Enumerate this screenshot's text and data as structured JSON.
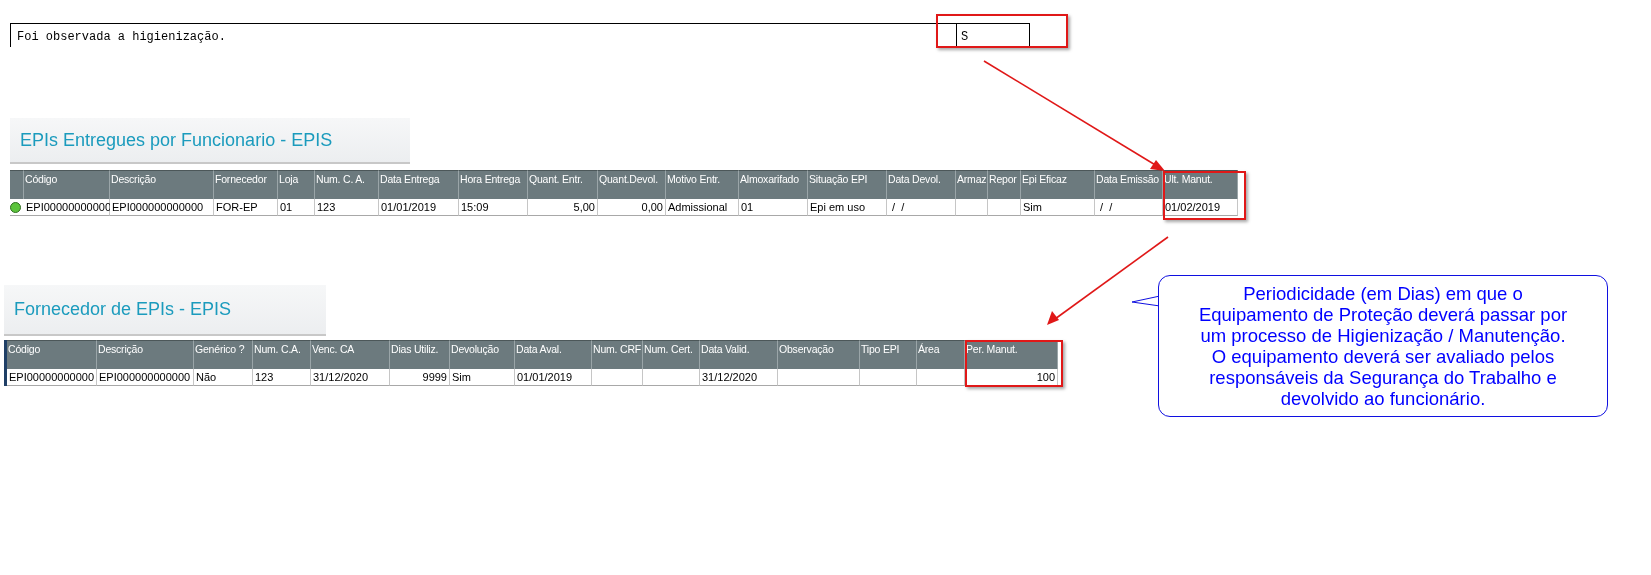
{
  "note_row": {
    "text": "Foi observada a higienização.",
    "value": "S"
  },
  "delivered_section": {
    "title": "EPIs Entregues por Funcionario - EPIS",
    "columns": [
      "Código",
      "Descrição",
      "Fornecedor",
      "Loja",
      "Num. C. A.",
      "Data Entrega",
      "Hora Entrega",
      "Quant. Entr.",
      "Quant.Devol.",
      "Motivo Entr.",
      "Almoxarifado",
      "Situação EPI",
      "Data Devol.",
      "Armaz",
      "Repor",
      "Epi Eficaz",
      "Data Emissão",
      "Ult. Manut."
    ],
    "rows": [
      {
        "color": "#5cc43c",
        "cells": [
          "EPI00000000000",
          "EPI000000000000",
          "FOR-EP",
          "01",
          "123",
          "01/01/2019",
          "15:09",
          "5,00",
          "0,00",
          "Admissional",
          "01",
          "Epi em uso",
          " /  /",
          "",
          "",
          "Sim",
          " /  /",
          "01/02/2019"
        ]
      }
    ]
  },
  "supplier_section": {
    "title": "Fornecedor de EPIs - EPIS",
    "columns": [
      "Código",
      "Descrição",
      "Genérico ?",
      "Num. C.A.",
      "Venc. CA",
      "Dias Utiliz.",
      "Devolução",
      "Data Aval.",
      "Num. CRF",
      "Num. Cert.",
      "Data Valid.",
      "Observação",
      "Tipo EPI",
      "Área",
      "Per. Manut."
    ],
    "rows": [
      {
        "cells": [
          "EPI00000000000",
          "EPI000000000000",
          "Não",
          "123",
          "31/12/2020",
          "9999",
          "Sim",
          "01/01/2019",
          "",
          "",
          "31/12/2020",
          "",
          "",
          "",
          "100"
        ]
      }
    ]
  },
  "callout": {
    "text": "Periodicidade (em Dias) em que o Equipamento de Proteção deverá passar por um processo de Higienização / Manutenção. O equipamento deverá ser avaliado pelos responsáveis da Segurança do Trabalho e devolvido ao funcionário."
  }
}
